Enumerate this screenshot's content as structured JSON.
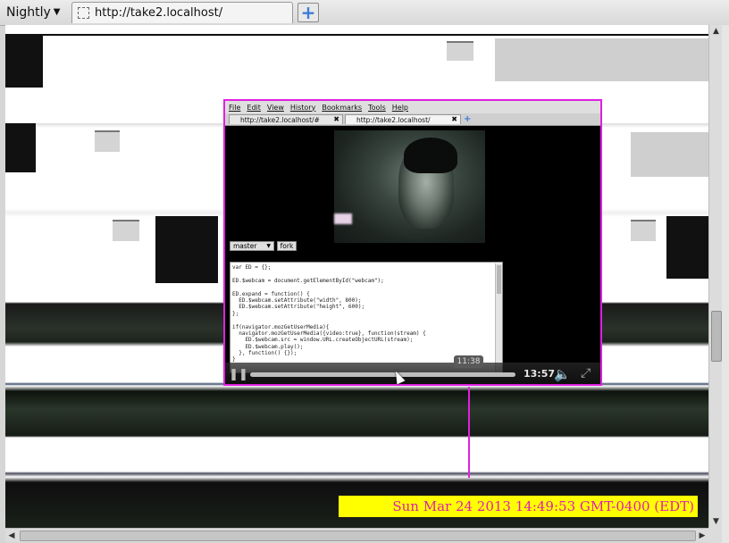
{
  "browser": {
    "app_menu_label": "Nightly",
    "tab_title": "http://take2.localhost/",
    "new_tab_symbol": "+"
  },
  "video": {
    "inner_menu": [
      "File",
      "Edit",
      "View",
      "History",
      "Bookmarks",
      "Tools",
      "Help"
    ],
    "inner_tabs": [
      {
        "title": "http://take2.localhost/#"
      },
      {
        "title": "http://take2.localhost/"
      }
    ],
    "branch_select_value": "master",
    "fork_button_label": "fork",
    "code_lines": [
      "var ED = {};",
      "",
      "ED.$webcam = document.getElementById(\"webcam\");",
      "",
      "ED.expand = function() {",
      "  ED.$webcam.setAttribute(\"width\", 800);",
      "  ED.$webcam.setAttribute(\"height\", 600);",
      "};",
      "",
      "if(navigator.mozGetUserMedia){",
      "  navigator.mozGetUserMedia({video:true}, function(stream) {",
      "    ED.$webcam.src = window.URL.createObjectURL(stream);",
      "    ED.$webcam.play();",
      "  }, function() {});",
      "}"
    ],
    "current_time_tooltip": "11:38",
    "duration": "13:57",
    "progress_fraction": 0.0
  },
  "overlay": {
    "timestamp": "Sun Mar 24 2013 14:49:53 GMT-0400 (EDT)"
  },
  "colors": {
    "highlight": "#e020e0",
    "banner_bg": "#ffff00"
  }
}
